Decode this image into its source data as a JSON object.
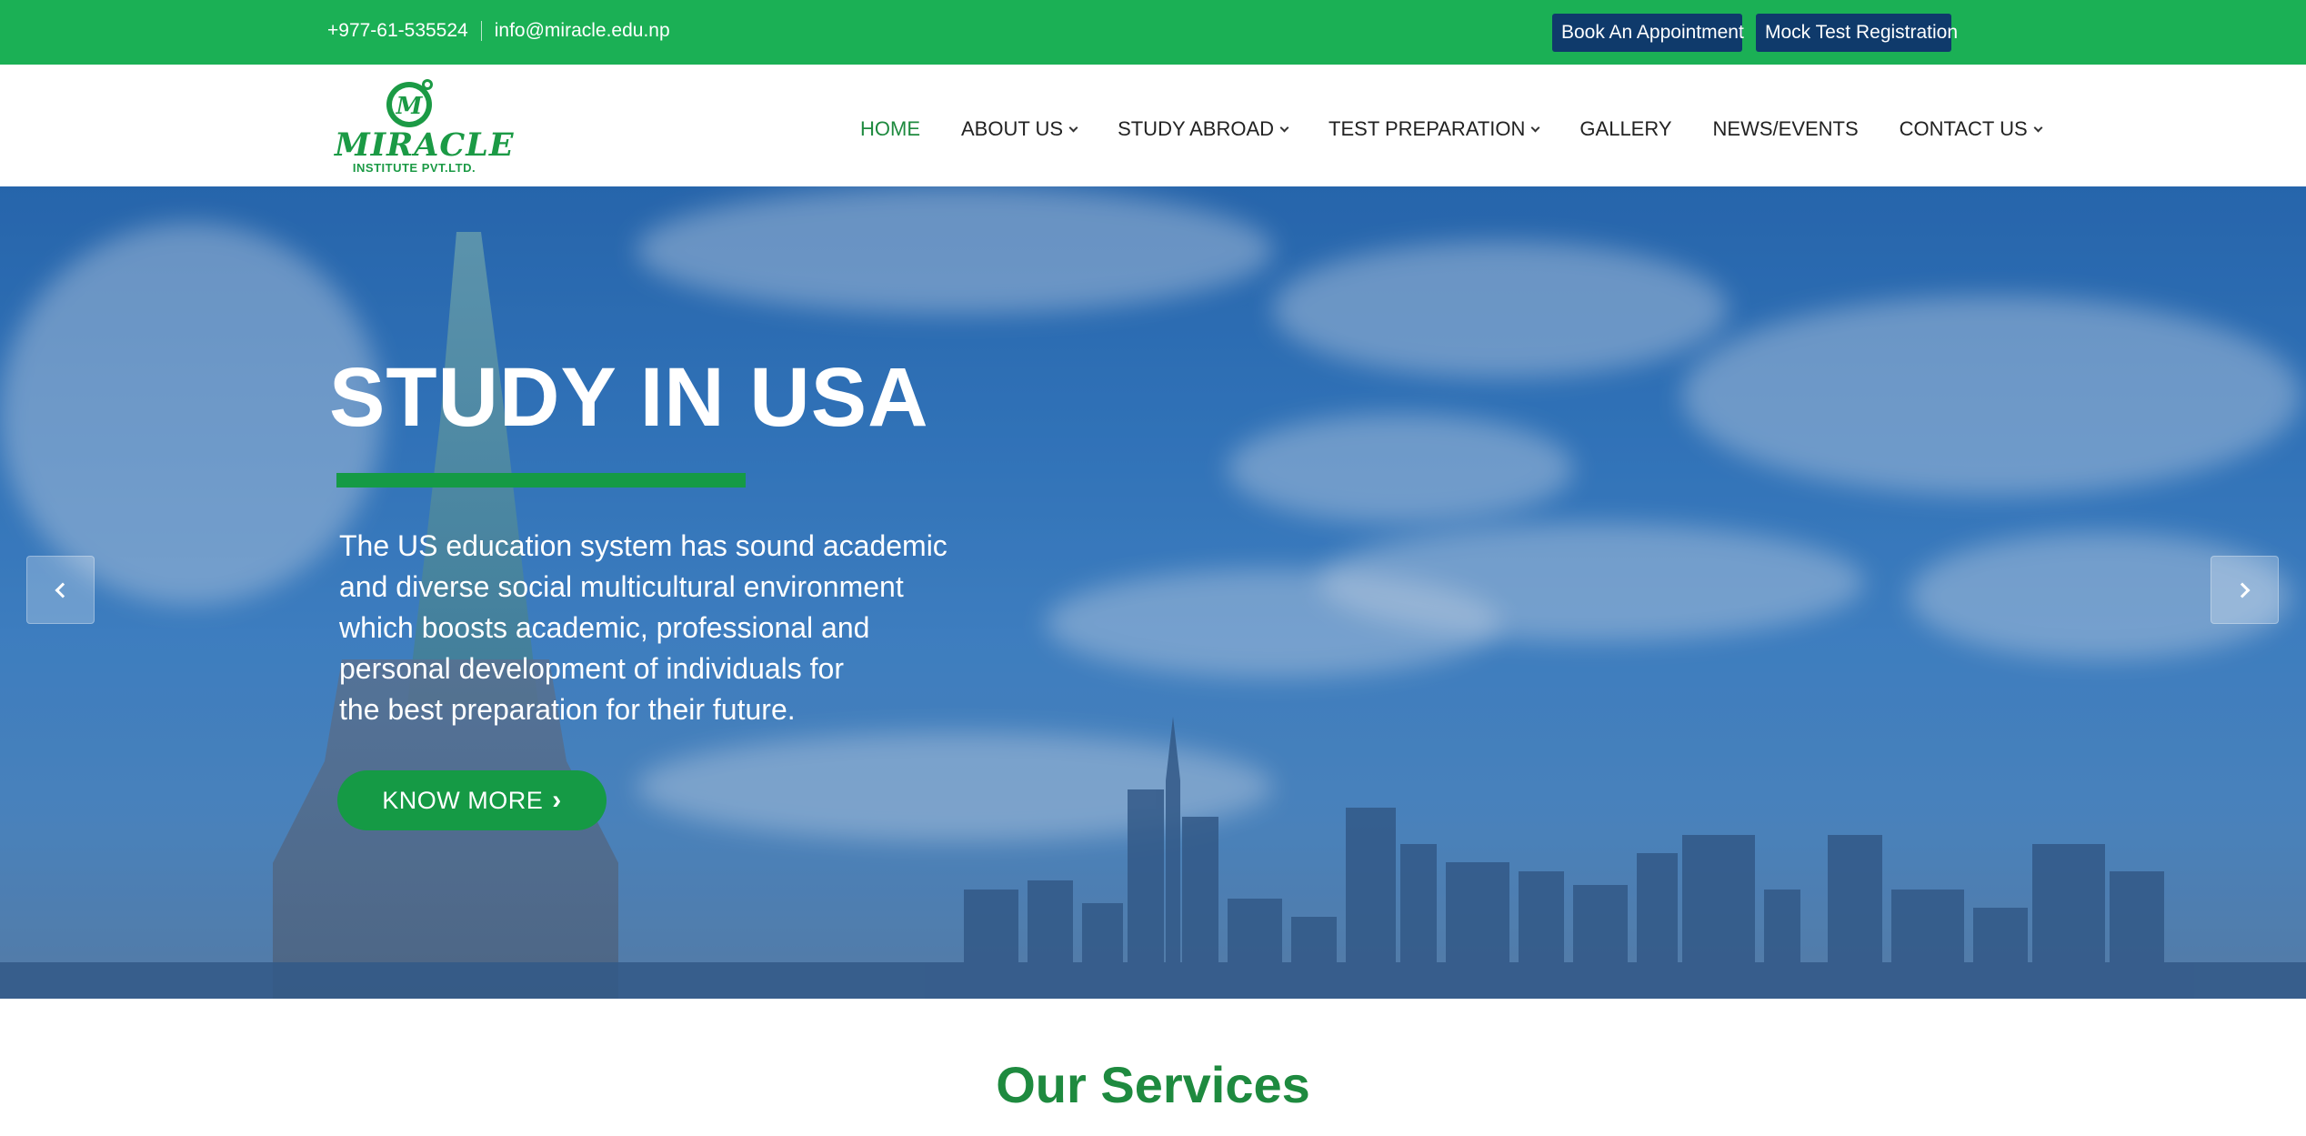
{
  "topbar": {
    "phone": "+977-61-535524",
    "email": "info@miracle.edu.np",
    "appointment_label": "Book An Appointment",
    "mock_test_label": "Mock Test Registration"
  },
  "logo": {
    "name": "MIRACLE",
    "subtitle": "INSTITUTE PVT.LTD."
  },
  "nav": {
    "items": [
      {
        "label": "HOME",
        "active": true
      },
      {
        "label": "ABOUT US",
        "dropdown": true
      },
      {
        "label": "STUDY ABROAD",
        "dropdown": true
      },
      {
        "label": "TEST PREPARATION",
        "dropdown": true
      },
      {
        "label": "GALLERY"
      },
      {
        "label": "NEWS/EVENTS"
      },
      {
        "label": "CONTACT US",
        "dropdown": true
      }
    ]
  },
  "hero": {
    "title": "STUDY IN USA",
    "text_lines": [
      "The US education system has sound academic",
      "and diverse social multicultural environment",
      "which boosts academic, professional and",
      "personal development of individuals for",
      "the best preparation for their future."
    ],
    "cta_label": "KNOW MORE",
    "prev_icon": "chevron-left-icon",
    "next_icon": "chevron-right-icon"
  },
  "services": {
    "heading": "Our Services"
  },
  "colors": {
    "topbar": "#1bb055",
    "button_dark": "#0f3a6b",
    "brand_green": "#159a45",
    "nav_active": "#1e8a3f"
  }
}
